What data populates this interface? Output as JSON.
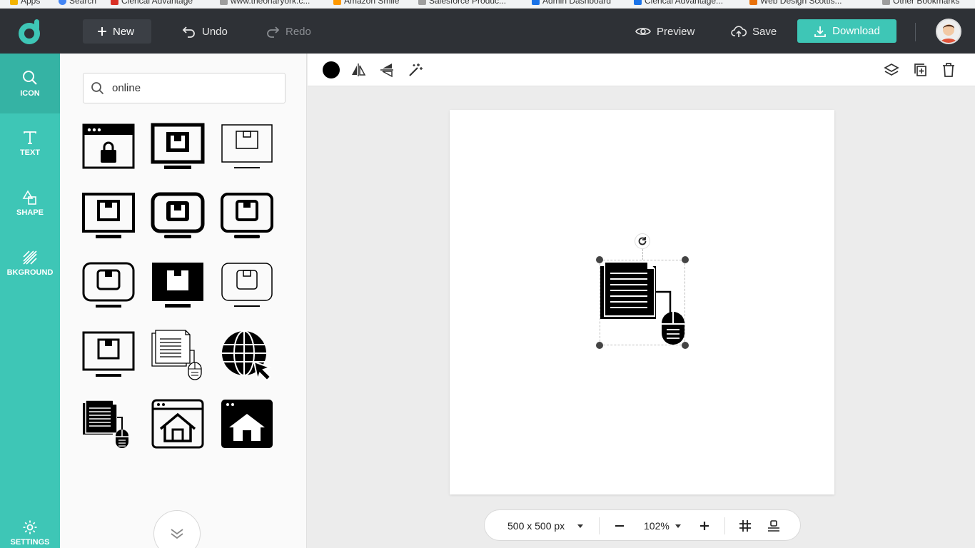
{
  "bookmarks": [
    {
      "label": "Apps",
      "color": "#f4b400"
    },
    {
      "label": "Search",
      "color": "#4285f4"
    },
    {
      "label": "Clerical Advantage",
      "color": "#d93025"
    },
    {
      "label": "www.theoriaryork.c...",
      "color": "#9e9e9e"
    },
    {
      "label": "Amazon Smile",
      "color": "#ff9900"
    },
    {
      "label": "Salesforce Produc...",
      "color": "#9e9e9e"
    },
    {
      "label": "Admin Dashboard",
      "color": "#1a73e8"
    },
    {
      "label": "Clerical Advantage...",
      "color": "#1a73e8"
    },
    {
      "label": "Web Design Scottis...",
      "color": "#e8710a"
    },
    {
      "label": "Other Bookmarks",
      "color": "#9e9e9e"
    }
  ],
  "header": {
    "new_label": "New",
    "undo_label": "Undo",
    "redo_label": "Redo",
    "preview_label": "Preview",
    "save_label": "Save",
    "download_label": "Download"
  },
  "rail": {
    "icon_label": "ICON",
    "text_label": "TEXT",
    "shape_label": "SHAPE",
    "background_label": "BKGROUND",
    "settings_label": "SETTINGS"
  },
  "search": {
    "value": "online",
    "placeholder": ""
  },
  "icon_results": [
    "browser-shopping-bag-icon",
    "monitor-box-thick-icon",
    "monitor-box-thin-icon",
    "monitor-box-icon",
    "monitor-box-rounded-icon",
    "monitor-box-rounded-alt-icon",
    "monitor-box-rounded-thin-icon",
    "monitor-box-filled-icon",
    "monitor-box-outline-icon",
    "monitor-box-classic-icon",
    "documents-mouse-outline-icon",
    "globe-cursor-icon",
    "documents-mouse-filled-icon",
    "browser-home-outline-icon",
    "browser-home-filled-icon"
  ],
  "toolbar": {
    "color": "#000000"
  },
  "canvas_object": "documents-mouse-filled-icon",
  "footer": {
    "size_label": "500 x 500 px",
    "zoom_label": "102%"
  },
  "colors": {
    "accent": "#3ec6b6",
    "topbar": "#2e3136"
  }
}
